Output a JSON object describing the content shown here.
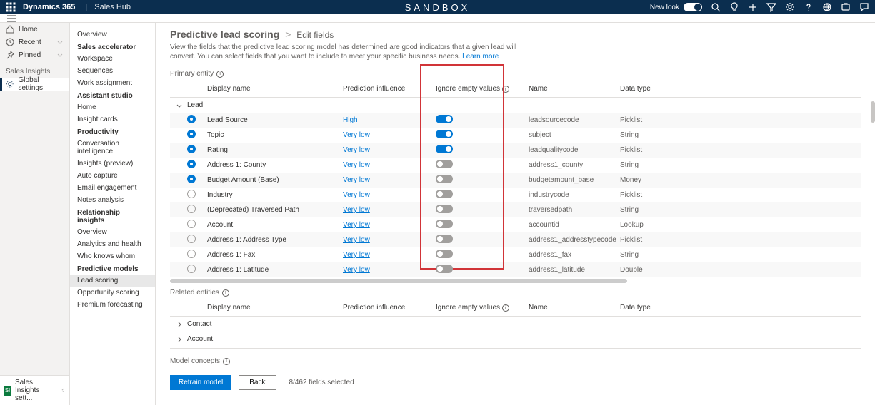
{
  "topbar": {
    "product": "Dynamics 365",
    "app": "Sales Hub",
    "center": "SANDBOX",
    "newlook": "New look"
  },
  "nav": {
    "home": "Home",
    "recent": "Recent",
    "pinned": "Pinned",
    "insights": "Sales Insights",
    "globalsettings": "Global settings",
    "footer": "Sales Insights sett..."
  },
  "side": {
    "overview": "Overview",
    "sales_accel": "Sales accelerator",
    "workspace": "Workspace",
    "sequences": "Sequences",
    "workassign": "Work assignment",
    "assistant_studio": "Assistant studio",
    "home2": "Home",
    "insight_cards": "Insight cards",
    "productivity": "Productivity",
    "conv_intel": "Conversation intelligence",
    "insights_preview": "Insights (preview)",
    "auto_capture": "Auto capture",
    "email_engagement": "Email engagement",
    "notes_analysis": "Notes analysis",
    "rel_insights": "Relationship insights",
    "overview2": "Overview",
    "analytics_health": "Analytics and health",
    "who_knows": "Who knows whom",
    "predictive_models": "Predictive models",
    "lead_scoring": "Lead scoring",
    "opp_scoring": "Opportunity scoring",
    "premium_forecast": "Premium forecasting"
  },
  "content": {
    "heading_parent": "Predictive lead scoring",
    "heading_child": "Edit fields",
    "desc1": "View the fields that the predictive lead scoring model has determined are good indicators that a given lead will convert. You can select fields that you want to include to meet your specific business needs. ",
    "learn_more": "Learn more",
    "primary_entity": "Primary entity",
    "related_entities": "Related entities",
    "model_concepts": "Model concepts",
    "th_display": "Display name",
    "th_influence": "Prediction influence",
    "th_ignore": "Ignore empty values",
    "th_name": "Name",
    "th_type": "Data type",
    "group_lead": "Lead",
    "group_contact": "Contact",
    "group_account": "Account",
    "rows": [
      {
        "sel": true,
        "display": "Lead Source",
        "inf": "High",
        "tog": true,
        "name": "leadsourcecode",
        "type": "Picklist"
      },
      {
        "sel": true,
        "display": "Topic",
        "inf": "Very low",
        "tog": true,
        "name": "subject",
        "type": "String"
      },
      {
        "sel": true,
        "display": "Rating",
        "inf": "Very low",
        "tog": true,
        "name": "leadqualitycode",
        "type": "Picklist"
      },
      {
        "sel": true,
        "display": "Address 1: County",
        "inf": "Very low",
        "tog": false,
        "name": "address1_county",
        "type": "String"
      },
      {
        "sel": true,
        "display": "Budget Amount (Base)",
        "inf": "Very low",
        "tog": false,
        "name": "budgetamount_base",
        "type": "Money"
      },
      {
        "sel": false,
        "display": "Industry",
        "inf": "Very low",
        "tog": false,
        "name": "industrycode",
        "type": "Picklist"
      },
      {
        "sel": false,
        "display": "(Deprecated) Traversed Path",
        "inf": "Very low",
        "tog": false,
        "name": "traversedpath",
        "type": "String"
      },
      {
        "sel": false,
        "display": "Account",
        "inf": "Very low",
        "tog": false,
        "name": "accountid",
        "type": "Lookup"
      },
      {
        "sel": false,
        "display": "Address 1: Address Type",
        "inf": "Very low",
        "tog": false,
        "name": "address1_addresstypecode",
        "type": "Picklist"
      },
      {
        "sel": false,
        "display": "Address 1: Fax",
        "inf": "Very low",
        "tog": false,
        "name": "address1_fax",
        "type": "String"
      },
      {
        "sel": false,
        "display": "Address 1: Latitude",
        "inf": "Very low",
        "tog": false,
        "name": "address1_latitude",
        "type": "Double"
      }
    ],
    "retrain": "Retrain model",
    "back": "Back",
    "selected_count": "8/462 fields selected"
  }
}
